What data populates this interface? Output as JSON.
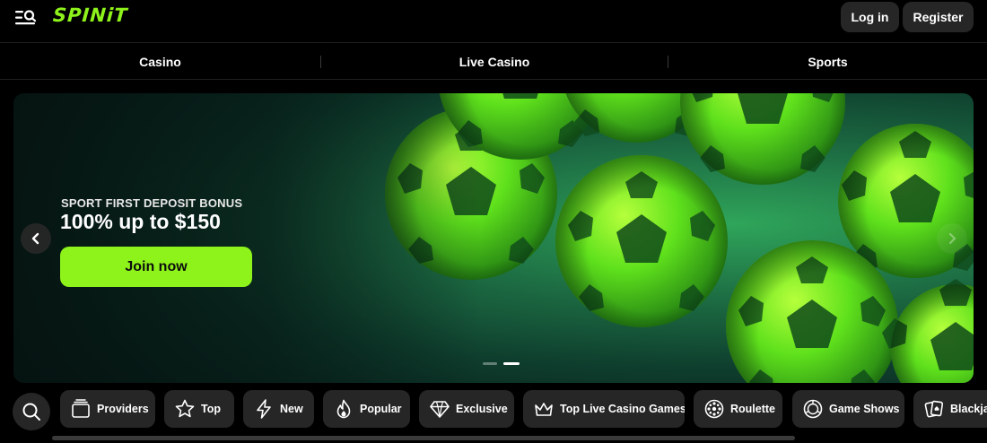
{
  "header": {
    "logo": "SPINiT",
    "login_label": "Log in",
    "register_label": "Register"
  },
  "nav": {
    "items": [
      {
        "label": "Casino"
      },
      {
        "label": "Live Casino"
      },
      {
        "label": "Sports"
      }
    ]
  },
  "banner": {
    "subtitle": "SPORT FIRST DEPOSIT BONUS",
    "title": "100% up to $150",
    "cta_label": "Join now",
    "slide_count": 2,
    "active_slide": 2
  },
  "categories": {
    "items": [
      {
        "label": "Providers",
        "icon": "providers-icon"
      },
      {
        "label": "Top",
        "icon": "star-icon"
      },
      {
        "label": "New",
        "icon": "lightning-icon"
      },
      {
        "label": "Popular",
        "icon": "flame-icon"
      },
      {
        "label": "Exclusive",
        "icon": "diamond-icon"
      },
      {
        "label": "Top Live Casino Games",
        "icon": "crown-icon"
      },
      {
        "label": "Roulette",
        "icon": "roulette-icon"
      },
      {
        "label": "Game Shows",
        "icon": "game-shows-icon"
      },
      {
        "label": "Blackjack",
        "icon": "cards-icon"
      }
    ]
  },
  "colors": {
    "accent": "#8ef31b",
    "background": "#000000",
    "chip": "#262626"
  }
}
